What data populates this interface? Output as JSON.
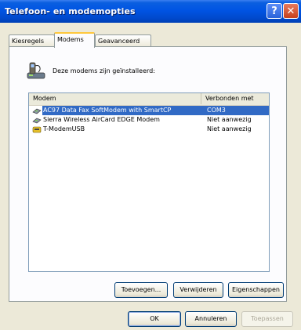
{
  "window": {
    "title": "Telefoon- en modemopties"
  },
  "titlebar": {
    "help_glyph": "?",
    "close_glyph": "✕"
  },
  "tabs": [
    {
      "label": "Kiesregels"
    },
    {
      "label": "Modems"
    },
    {
      "label": "Geavanceerd"
    }
  ],
  "info": {
    "text": "Deze modems zijn geïnstalleerd:",
    "icon": "phone-modem-icon"
  },
  "list": {
    "columns": [
      {
        "label": "Modem"
      },
      {
        "label": "Verbonden met"
      }
    ],
    "rows": [
      {
        "modem": "AC97 Data Fax SoftModem with SmartCP",
        "connected": "COM3",
        "icon": "modem-icon",
        "selected": true
      },
      {
        "modem": "Sierra Wireless AirCard EDGE Modem",
        "connected": "Niet aanwezig",
        "icon": "modem-icon",
        "selected": false
      },
      {
        "modem": "T-ModemUSB",
        "connected": "Niet aanwezig",
        "icon": "usb-modem-icon",
        "selected": false
      }
    ]
  },
  "panel_buttons": {
    "add": "Toevoegen...",
    "remove": "Verwijderen",
    "properties": "Eigenschappen"
  },
  "dialog_buttons": {
    "ok": "OK",
    "cancel": "Annuleren",
    "apply": "Toepassen"
  },
  "colors": {
    "titlebar": "#0054e3",
    "selection": "#316ac5",
    "face": "#ece9d8"
  }
}
